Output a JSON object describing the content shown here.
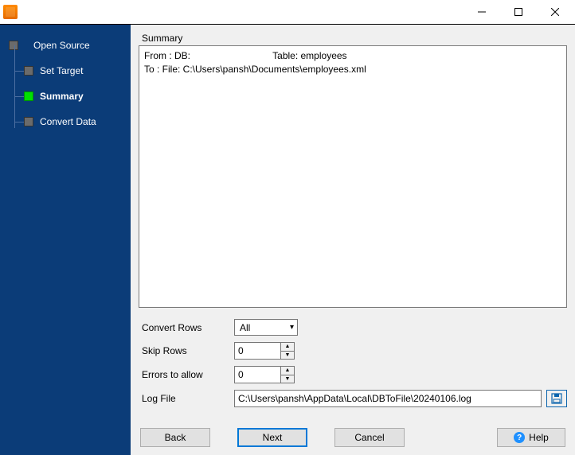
{
  "window": {
    "title": ""
  },
  "sidebar": {
    "steps": [
      {
        "label": "Open Source",
        "current": false
      },
      {
        "label": "Set Target",
        "current": false
      },
      {
        "label": "Summary",
        "current": true
      },
      {
        "label": "Convert Data",
        "current": false
      }
    ]
  },
  "summary": {
    "heading": "Summary",
    "line1_from": "From : DB:",
    "line1_table": "Table: employees",
    "line2": "To : File: C:\\Users\\pansh\\Documents\\employees.xml"
  },
  "form": {
    "convert_rows_label": "Convert Rows",
    "convert_rows_value": "All",
    "skip_rows_label": "Skip Rows",
    "skip_rows_value": "0",
    "errors_label": "Errors to allow",
    "errors_value": "0",
    "logfile_label": "Log File",
    "logfile_value": "C:\\Users\\pansh\\AppData\\Local\\DBToFile\\20240106.log"
  },
  "buttons": {
    "back": "Back",
    "next": "Next",
    "cancel": "Cancel",
    "help": "Help"
  }
}
